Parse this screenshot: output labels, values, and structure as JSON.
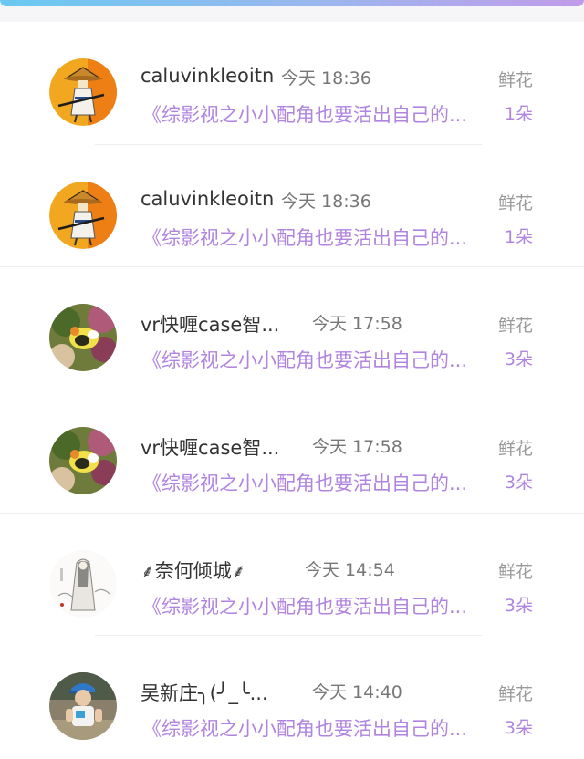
{
  "header": {
    "accent_gradient": [
      "#69c9f0",
      "#9bb7ee",
      "#c19be8"
    ]
  },
  "colors": {
    "book_title": "#b184df",
    "username": "#333333",
    "time": "#777777",
    "gift_label": "#9a9a9a"
  },
  "gifts": [
    {
      "avatar": "straw-hat-swordsman-avatar",
      "username": "caluvinkleoitn",
      "time": "今天 18:36",
      "book": "《综影视之小小配角也要活出自己的...",
      "gift": "鲜花",
      "count": "1朵"
    },
    {
      "avatar": "straw-hat-swordsman-avatar",
      "username": "caluvinkleoitn",
      "time": "今天 18:36",
      "book": "《综影视之小小配角也要活出自己的...",
      "gift": "鲜花",
      "count": "1朵"
    },
    {
      "avatar": "flower-photo-avatar",
      "username": "vr快喱case智...",
      "time": "今天 17:58",
      "book": "《综影视之小小配角也要活出自己的...",
      "gift": "鲜花",
      "count": "3朵"
    },
    {
      "avatar": "flower-photo-avatar",
      "username": "vr快喱case智...",
      "time": "今天 17:58",
      "book": "《综影视之小小配角也要活出自己的...",
      "gift": "鲜花",
      "count": "3朵"
    },
    {
      "avatar": "ink-painting-lady-avatar",
      "username": "⸙奈何倾城⸙",
      "time": "今天 14:54",
      "book": "《综影视之小小配角也要活出自己的...",
      "gift": "鲜花",
      "count": "3朵"
    },
    {
      "avatar": "child-in-cap-photo-avatar",
      "username": "吴新庄╮(╯_╰...",
      "time": "今天 14:40",
      "book": "《综影视之小小配角也要活出自己的...",
      "gift": "鲜花",
      "count": "3朵"
    }
  ]
}
